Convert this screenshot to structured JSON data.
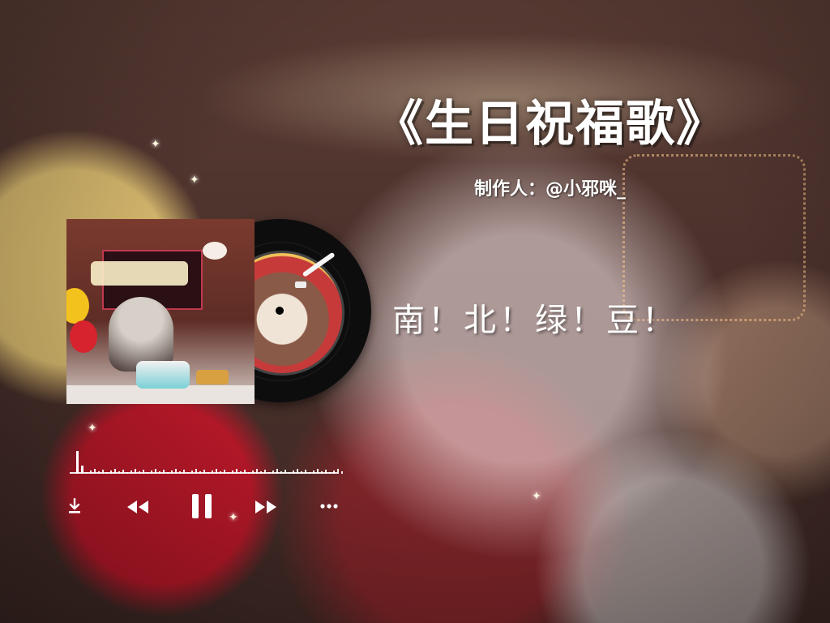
{
  "song": {
    "title": "《生日祝福歌》",
    "producer": "制作人：@小邪咪_",
    "lyric": "南！北！绿！豆！"
  },
  "player": {
    "state": "playing",
    "controls": [
      "download-icon",
      "previous-icon",
      "pause-icon",
      "next-icon",
      "more-icon"
    ]
  },
  "colors": {
    "text": "#ffffff",
    "vinyl": "#0d0d0d",
    "accent_red": "#c63a3a"
  }
}
